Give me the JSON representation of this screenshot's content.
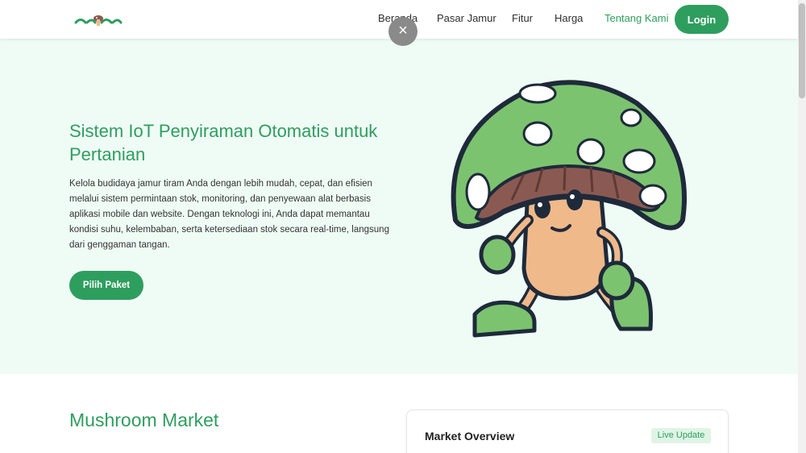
{
  "nav": {
    "links": [
      "Beranda",
      "Pasar Jamur",
      "Fitur",
      "Harga",
      "Tentang Kami"
    ],
    "login_label": "Login"
  },
  "overlay": {
    "close_glyph": "×"
  },
  "hero": {
    "title": "Sistem IoT Penyiraman Otomatis untuk Pertanian",
    "description": "Kelola budidaya jamur tiram Anda dengan lebih mudah, cepat, dan efisien melalui sistem permintaan stok, monitoring, dan penyewaan alat berbasis aplikasi mobile dan website. Dengan teknologi ini, Anda dapat memantau kondisi suhu, kelembaban, serta ketersediaan stok secara real-time, langsung dari genggaman tangan.",
    "cta_label": "Pilih Paket"
  },
  "market": {
    "title": "Mushroom Market",
    "card_title": "Market Overview",
    "badge": "Live Update"
  },
  "colors": {
    "brand_green": "#2e9e5e",
    "hero_bg": "#effcf6",
    "badge_bg": "#dff4e6",
    "mushroom_cap": "#7cc36f",
    "mushroom_gills": "#8a5a52",
    "mushroom_body": "#f0b98a"
  },
  "icons": {
    "logo": "mushroom-logo",
    "close": "close-icon",
    "mascot": "mushroom-mascot-illustration"
  }
}
